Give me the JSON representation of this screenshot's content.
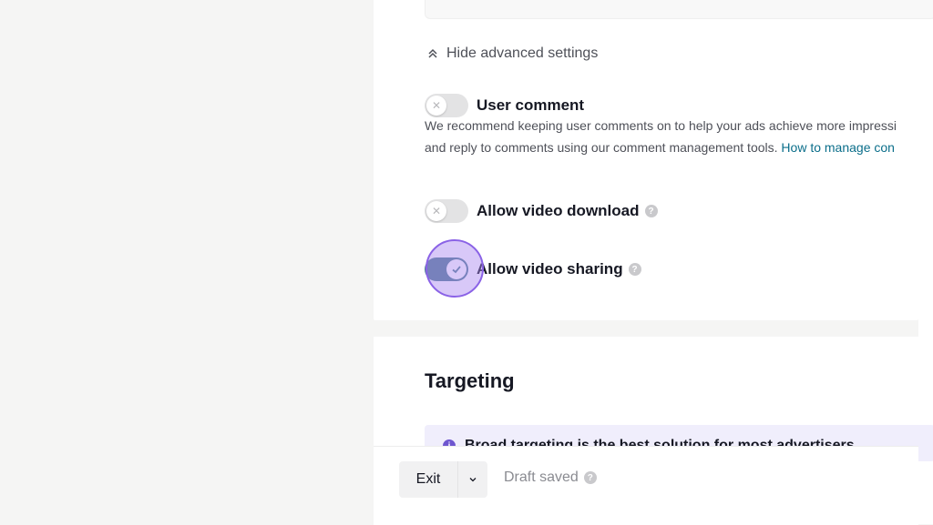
{
  "advanced": {
    "toggle_label": "Hide advanced settings"
  },
  "options": {
    "user_comment": {
      "label": "User comment",
      "enabled": false,
      "description_line1": "We recommend keeping user comments on to help your ads achieve more impressi",
      "description_line2": "and reply to comments using our comment management tools.",
      "link_text": "How to manage con"
    },
    "video_download": {
      "label": "Allow video download",
      "enabled": false
    },
    "video_sharing": {
      "label": "Allow video sharing",
      "enabled": true
    }
  },
  "targeting": {
    "title": "Targeting",
    "banner_text": "Broad targeting is the best solution for most advertisers"
  },
  "footer": {
    "exit_label": "Exit",
    "draft_status": "Draft saved"
  },
  "colors": {
    "toggle_on": "#4f7f93",
    "link": "#0b6e8a",
    "highlight": "#8a62e6",
    "banner_bg": "#f0eefc"
  }
}
